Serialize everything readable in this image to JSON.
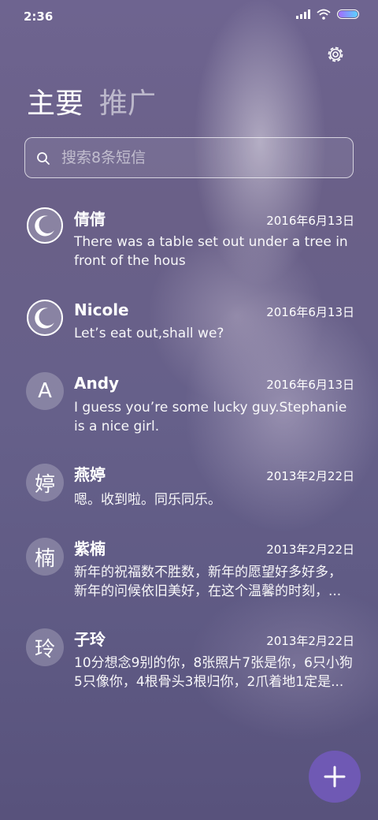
{
  "status": {
    "time": "2:36"
  },
  "header": {
    "tabs": [
      {
        "label": "主要"
      },
      {
        "label": "推广"
      }
    ]
  },
  "search": {
    "placeholder": "搜索8条短信"
  },
  "conversations": [
    {
      "name": "倩倩",
      "date": "2016年6月13日",
      "preview": "There was a table set out under a tree in front of the hous",
      "avatar": "moon-icon"
    },
    {
      "name": "Nicole",
      "date": "2016年6月13日",
      "preview": "Let’s eat out,shall we?",
      "avatar": "moon-icon"
    },
    {
      "name": "Andy",
      "date": "2016年6月13日",
      "preview": "I guess you’re some lucky guy.Stephanie is a nice girl.",
      "avatar_char": "A"
    },
    {
      "name": "燕婷",
      "date": "2013年2月22日",
      "preview": "嗯。收到啦。同乐同乐。",
      "avatar_char": "婷"
    },
    {
      "name": "紫楠",
      "date": "2013年2月22日",
      "preview": "新年的祝福数不胜数，新年的愿望好多好多，新年的问候依旧美好，在这个温馨的时刻，...",
      "avatar_char": "楠"
    },
    {
      "name": "子玲",
      "date": "2013年2月22日",
      "preview": "10分想念9别的你，8张照片7张是你，6只小狗5只像你，4根骨头3根归你，2爪着地1定是...",
      "avatar_char": "玲"
    }
  ],
  "fab": {
    "icon": "plus-icon"
  },
  "colors": {
    "fab": "#6f59b4",
    "background": "#66608a"
  }
}
